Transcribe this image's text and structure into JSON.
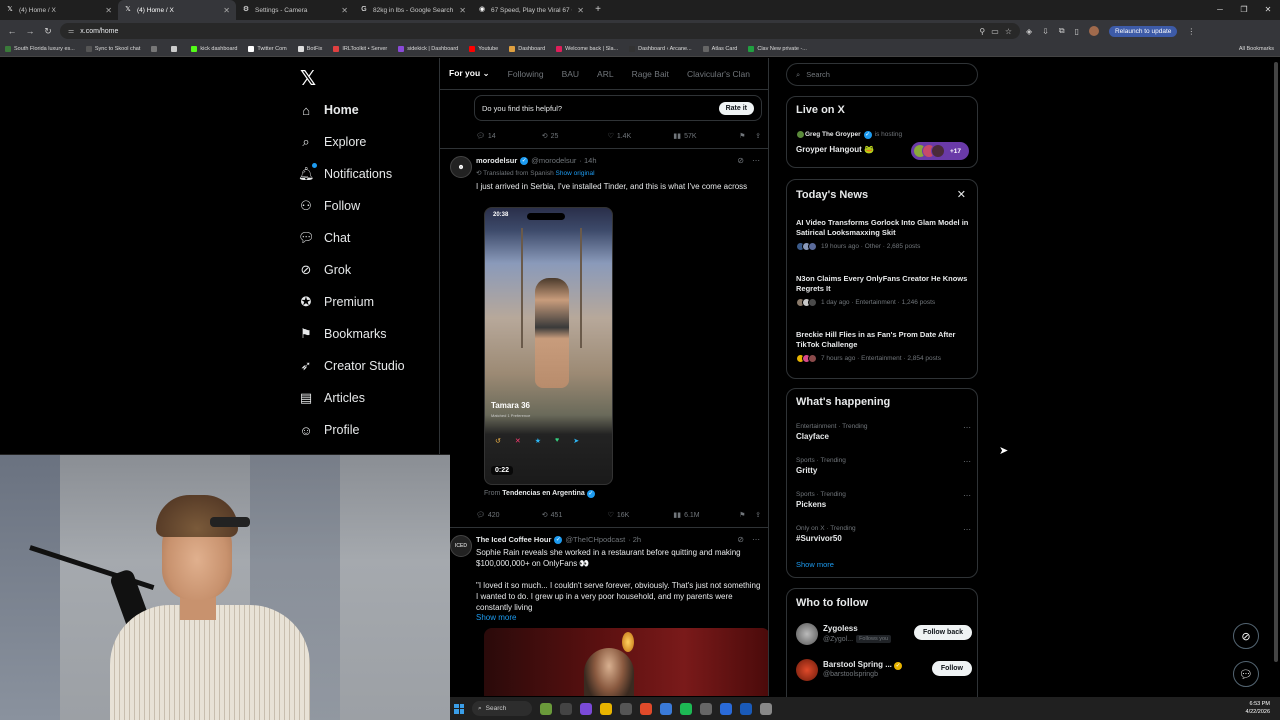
{
  "browser": {
    "tabs": [
      {
        "label": "(4) Home / X",
        "icon": "x-icon",
        "active": false
      },
      {
        "label": "(4) Home / X",
        "icon": "x-icon",
        "active": true
      },
      {
        "label": "Settings - Camera",
        "icon": "gear-icon",
        "active": false
      },
      {
        "label": "82kg in lbs - Google Search",
        "icon": "google-icon",
        "active": false
      },
      {
        "label": "67 Speed, Play the Viral 67 Gam",
        "icon": "game-icon",
        "active": false
      }
    ],
    "url": "x.com/home",
    "relaunch_label": "Relaunch to update",
    "bookmarks": [
      {
        "label": "South Florida luxury es...",
        "color": "#3a7a3a"
      },
      {
        "label": "Sync to Skool chat",
        "color": "#555555"
      },
      {
        "label": "",
        "color": "#777777"
      },
      {
        "label": "",
        "color": "#cccccc"
      },
      {
        "label": "kick dashboard",
        "color": "#53fc18"
      },
      {
        "label": "Twitter Com",
        "color": "#ffffff"
      },
      {
        "label": "BotFix",
        "color": "#dddddd"
      },
      {
        "label": "IRLToolkit • Server",
        "color": "#e04040"
      },
      {
        "label": "sidekick | Dashboard",
        "color": "#8a4ad8"
      },
      {
        "label": "Youtube",
        "color": "#ff0000"
      },
      {
        "label": "Dashboard",
        "color": "#e0a040"
      },
      {
        "label": "Welcome back | Sla...",
        "color": "#e01e5a"
      },
      {
        "label": "Dashboard ‹ Arcane...",
        "color": "#333333"
      },
      {
        "label": "Atlas Card",
        "color": "#666666"
      },
      {
        "label": "Clav New private -...",
        "color": "#20a040"
      }
    ],
    "all_bookmarks": "All Bookmarks"
  },
  "nav": {
    "logo": "𝕏",
    "items": [
      {
        "label": "Home",
        "icon": "home-icon",
        "glyph": "⌂"
      },
      {
        "label": "Explore",
        "icon": "search-icon",
        "glyph": "⌕"
      },
      {
        "label": "Notifications",
        "icon": "bell-icon",
        "glyph": "🔔︎"
      },
      {
        "label": "Follow",
        "icon": "person-add-icon",
        "glyph": "⚇"
      },
      {
        "label": "Chat",
        "icon": "chat-icon",
        "glyph": "💬︎"
      },
      {
        "label": "Grok",
        "icon": "grok-icon",
        "glyph": "⊘"
      },
      {
        "label": "Premium",
        "icon": "verified-icon",
        "glyph": "✪"
      },
      {
        "label": "Bookmarks",
        "icon": "bookmark-icon",
        "glyph": "⚑"
      },
      {
        "label": "Creator Studio",
        "icon": "rocket-icon",
        "glyph": "➶"
      },
      {
        "label": "Articles",
        "icon": "article-icon",
        "glyph": "▤"
      },
      {
        "label": "Profile",
        "icon": "profile-icon",
        "glyph": "☺"
      }
    ]
  },
  "timeline": {
    "tabs": [
      "For you",
      "Following",
      "BAU",
      "ARL",
      "Rage Bait",
      "Clavicular's Clan",
      "E"
    ],
    "helpful_prompt": "Do you find this helpful?",
    "rate_label": "Rate it",
    "post0_actions": {
      "replies": "14",
      "reposts": "25",
      "likes": "1.4K",
      "views": "57K"
    },
    "post1": {
      "name": "morodelsur",
      "handle": "@morodelsur",
      "time": "· 14h",
      "translated": "Translated from Spanish",
      "show_original": "Show original",
      "text": "I just arrived in Serbia, I've installed Tinder, and this is what I've come across",
      "img_time": "20:38",
      "img_name": "Tamara  36",
      "img_sub": "Matched 1 Preference",
      "timer": "0:22",
      "from_label": "From",
      "from_source": "Tendencias en Argentina",
      "actions": {
        "replies": "420",
        "reposts": "451",
        "likes": "16K",
        "views": "6.1M"
      }
    },
    "post2": {
      "name": "The Iced Coffee Hour",
      "handle": "@TheICHpodcast",
      "time": "· 2h",
      "avatar_text": "ICED",
      "text": "Sophie Rain reveals she worked in a restaurant before quitting and making $100,000,000+ on OnlyFans 👀",
      "quote": "\"I loved it so much... I couldn't serve forever, obviously. That's just not something I wanted to do. I grew up in a very poor household, and my parents were constantly living",
      "show_more": "Show more"
    }
  },
  "sidebar": {
    "search_placeholder": "Search",
    "live": {
      "title": "Live on X",
      "host": "Greg The Groyper",
      "hosting": "is hosting",
      "space": "Groyper Hangout 🐸",
      "count": "+17"
    },
    "news": {
      "title": "Today's News",
      "items": [
        {
          "title": "AI Video Transforms Gorlock Into Glam Model in Satirical Looksmaxxing Skit",
          "meta": "19 hours ago · Other · 2,685 posts"
        },
        {
          "title": "N3on Claims Every OnlyFans Creator He Knows Regrets It",
          "meta": "1 day ago · Entertainment · 1,246 posts"
        },
        {
          "title": "Breckie Hill Flies in as Fan's Prom Date After TikTok Challenge",
          "meta": "7 hours ago · Entertainment · 2,854 posts"
        }
      ]
    },
    "happening": {
      "title": "What's happening",
      "items": [
        {
          "meta": "Entertainment · Trending",
          "name": "Clayface"
        },
        {
          "meta": "Sports · Trending",
          "name": "Gritty"
        },
        {
          "meta": "Sports · Trending",
          "name": "Pickens"
        },
        {
          "meta": "Only on X · Trending",
          "name": "#Survivor50"
        }
      ],
      "show_more": "Show more"
    },
    "who_to_follow": {
      "title": "Who to follow",
      "items": [
        {
          "name": "Zygoless",
          "handle": "@Zygol...",
          "follows_you": "Follows you",
          "button": "Follow back"
        },
        {
          "name": "Barstool Spring ...",
          "handle": "@barstoolspringb",
          "follows_you": "",
          "button": "Follow"
        }
      ]
    }
  },
  "taskbar": {
    "search": "Search",
    "time": "6:53 PM",
    "date": "4/22/2026"
  }
}
